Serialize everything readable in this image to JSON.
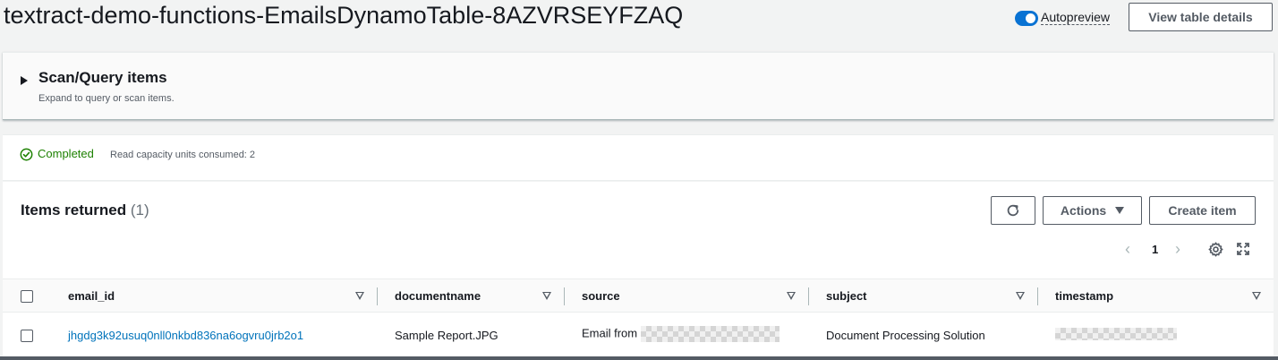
{
  "header": {
    "title": "textract-demo-functions-EmailsDynamoTable-8AZVRSEYFZAQ",
    "autopreview_label": "Autopreview",
    "autopreview_on": true,
    "view_details_label": "View table details"
  },
  "scan": {
    "title": "Scan/Query items",
    "description": "Expand to query or scan items."
  },
  "status": {
    "label": "Completed",
    "capacity": "Read capacity units consumed: 2",
    "color": "#1d8102"
  },
  "items": {
    "title": "Items returned",
    "count": "(1)",
    "actions_label": "Actions",
    "create_label": "Create item",
    "page": "1",
    "columns": [
      "email_id",
      "documentname",
      "source",
      "subject",
      "timestamp"
    ],
    "rows": [
      {
        "email_id": "jhgdg3k92usuq0nll0nkbd836na6ogvru0jrb2o1",
        "documentname": "Sample Report.JPG",
        "source": "Email from",
        "subject": "Document Processing Solution"
      }
    ]
  },
  "colors": {
    "accent": "#0972d3",
    "link": "#0073bb"
  }
}
